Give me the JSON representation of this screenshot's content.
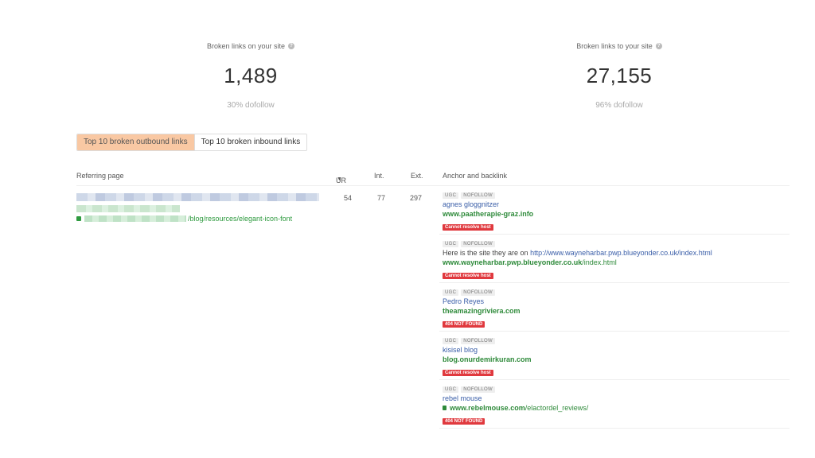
{
  "stats": {
    "left": {
      "label": "Broken links on your site",
      "value": "1,489",
      "sub": "30% dofollow"
    },
    "right": {
      "label": "Broken links to your site",
      "value": "27,155",
      "sub": "96% dofollow"
    },
    "help_glyph": "?"
  },
  "tabs": [
    {
      "label": "Top 10 broken outbound links",
      "active": true
    },
    {
      "label": "Top 10 broken inbound links",
      "active": false
    }
  ],
  "table": {
    "headers": {
      "referring": "Referring page",
      "ur": "UR",
      "int": "Int.",
      "ext": "Ext.",
      "anchor": "Anchor and backlink"
    },
    "sort_glyph": "▼",
    "row": {
      "ref_path": "/blog/resources/elegant-icon-font",
      "ur": "54",
      "int": "77",
      "ext": "297"
    },
    "entries": [
      {
        "tag1": "UGC",
        "tag2": "NOFOLLOW",
        "anchor": "agnes gloggnitzer",
        "backlink": "www.paatherapie-graz.info",
        "backlink_rest": "",
        "status": "Cannot resolve host"
      },
      {
        "tag1": "UGC",
        "tag2": "NOFOLLOW",
        "anchor_plain": "Here is the site they are on ",
        "anchor": "http://www.wayneharbar.pwp.blueyonder.co.uk/index.html",
        "backlink": "www.wayneharbar.pwp.blueyonder.co.uk",
        "backlink_rest": "/index.html",
        "status": "Cannot resolve host"
      },
      {
        "tag1": "UGC",
        "tag2": "NOFOLLOW",
        "anchor": "Pedro Reyes",
        "backlink": "theamazingriviera.com",
        "backlink_rest": "",
        "status": "404 NOT FOUND"
      },
      {
        "tag1": "UGC",
        "tag2": "NOFOLLOW",
        "anchor": "kisisel blog",
        "backlink": "blog.onurdemirkuran.com",
        "backlink_rest": "",
        "status": "Cannot resolve host"
      },
      {
        "tag1": "UGC",
        "tag2": "NOFOLLOW",
        "anchor": "rebel mouse",
        "backlink": "www.rebelmouse.com",
        "backlink_rest": "/elactordel_reviews/",
        "status": "404 NOT FOUND",
        "secure": true
      }
    ]
  },
  "colors": {
    "accent_tab": "#f9c8a3",
    "link_blue": "#3a5ea8",
    "link_green": "#2e8a3a",
    "error_red": "#e0393e"
  }
}
